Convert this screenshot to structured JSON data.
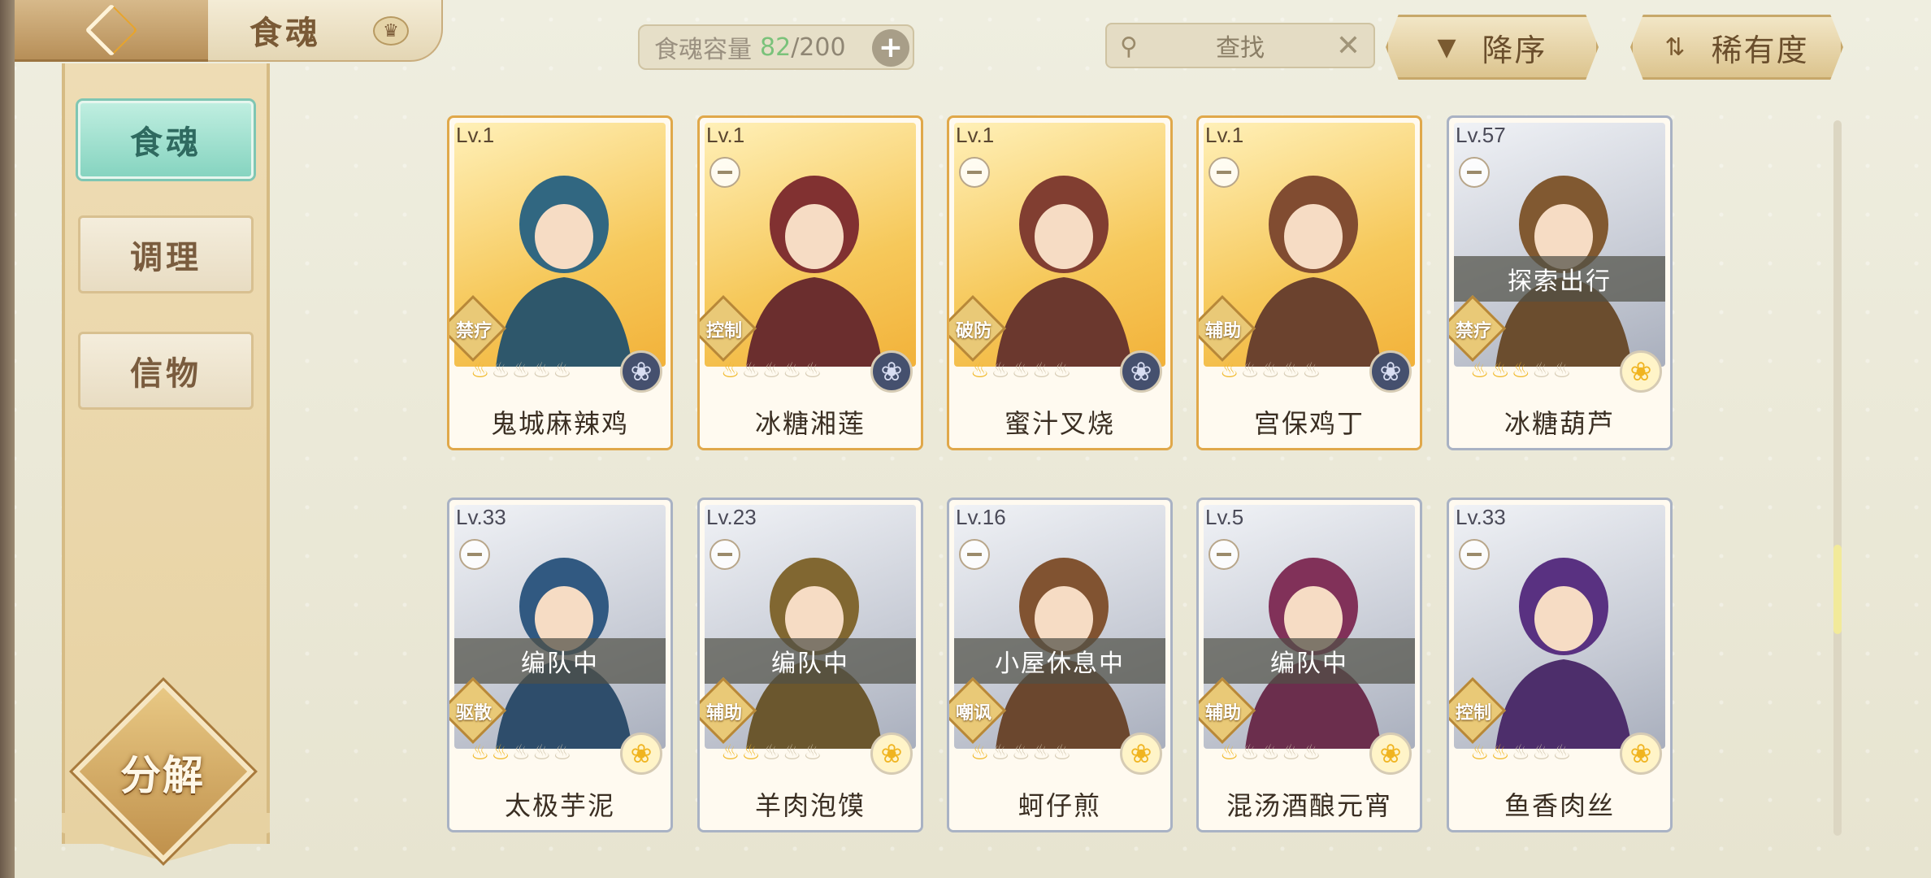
{
  "header": {
    "title": "食魂",
    "capacity_label": "食魂容量",
    "capacity_current": "82",
    "capacity_max": "/200",
    "search_label": "查找",
    "sort_label": "降序",
    "filter_label": "稀有度"
  },
  "sidebar": {
    "tabs": [
      {
        "label": "食魂"
      },
      {
        "label": "调理"
      },
      {
        "label": "信物"
      }
    ],
    "decompose_label": "分解"
  },
  "colors": {
    "gold_border": "#e0a84a",
    "silver_border": "#a9b2c4",
    "active_tab": "#86d4c0",
    "star_on": "#f0b828"
  },
  "cards": [
    {
      "lv": "Lv.1",
      "name": "鬼城麻辣鸡",
      "role": "禁疗",
      "stars": 1,
      "rarity": "gold",
      "element": "dark",
      "status": ""
    },
    {
      "lv": "Lv.1",
      "name": "冰糖湘莲",
      "role": "控制",
      "stars": 1,
      "rarity": "gold",
      "element": "dark",
      "status": ""
    },
    {
      "lv": "Lv.1",
      "name": "蜜汁叉烧",
      "role": "破防",
      "stars": 1,
      "rarity": "gold",
      "element": "dark",
      "status": ""
    },
    {
      "lv": "Lv.1",
      "name": "宫保鸡丁",
      "role": "辅助",
      "stars": 1,
      "rarity": "gold",
      "element": "dark",
      "status": ""
    },
    {
      "lv": "Lv.57",
      "name": "冰糖葫芦",
      "role": "禁疗",
      "stars": 3,
      "rarity": "silver",
      "element": "sun",
      "status": "探索出行"
    },
    {
      "lv": "Lv.33",
      "name": "太极芋泥",
      "role": "驱散",
      "stars": 2,
      "rarity": "silver",
      "element": "sun",
      "status": "编队中"
    },
    {
      "lv": "Lv.23",
      "name": "羊肉泡馍",
      "role": "辅助",
      "stars": 2,
      "rarity": "silver",
      "element": "sun",
      "status": "编队中"
    },
    {
      "lv": "Lv.16",
      "name": "蚵仔煎",
      "role": "嘲讽",
      "stars": 1,
      "rarity": "silver",
      "element": "sun",
      "status": "小屋休息中"
    },
    {
      "lv": "Lv.5",
      "name": "混汤酒酿元宵",
      "role": "辅助",
      "stars": 1,
      "rarity": "silver",
      "element": "sun",
      "status": "编队中"
    },
    {
      "lv": "Lv.33",
      "name": "鱼香肉丝",
      "role": "控制",
      "stars": 2,
      "rarity": "silver",
      "element": "sun",
      "status": ""
    }
  ]
}
